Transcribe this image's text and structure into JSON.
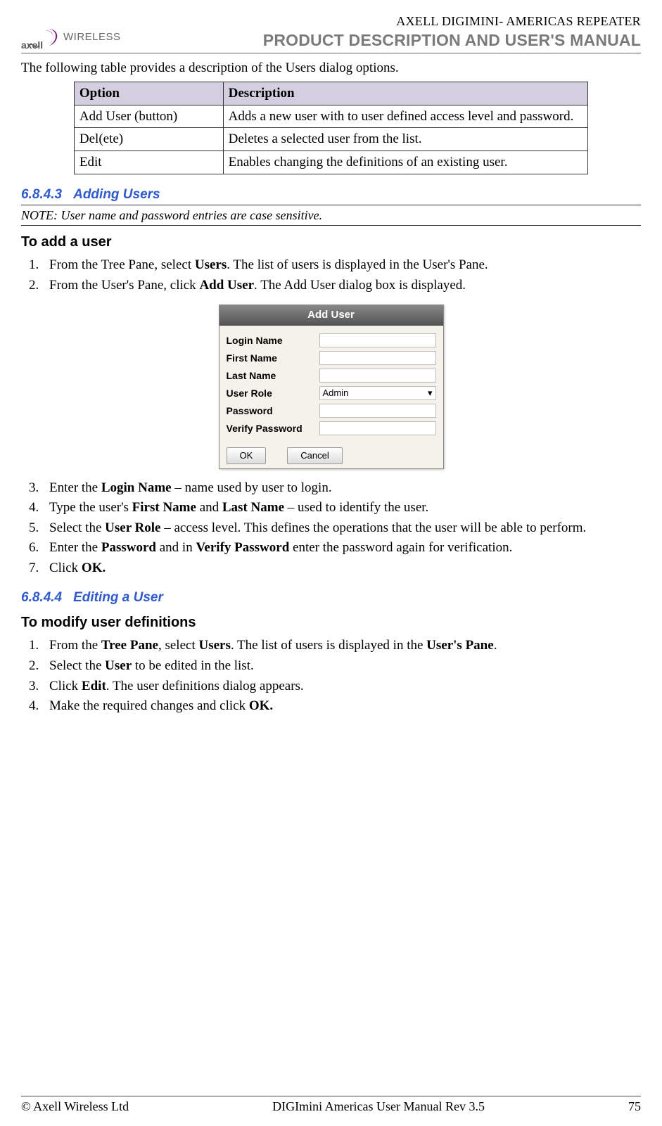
{
  "header": {
    "logo_text": "WIRELESS",
    "line1_a": "A",
    "line1_xell": "XELL ",
    "line1_d": "D",
    "line1_igimini": "IGIMINI",
    "line1_dash": "- ",
    "line1_am": "A",
    "line1_mericas": "MERICAS ",
    "line1_r": "R",
    "line1_epeater": "EPEATER",
    "line2": "PRODUCT DESCRIPTION AND USER'S MANUAL"
  },
  "intro": "The following table provides a description of the Users dialog options.",
  "table": {
    "headers": [
      "Option",
      "Description"
    ],
    "rows": [
      [
        "Add User (button)",
        "Adds a new user with to user defined access level and password."
      ],
      [
        "Del(ete)",
        "Deletes a selected user from the list."
      ],
      [
        "Edit",
        "Enables changing the definitions of an existing user."
      ]
    ]
  },
  "sec1": {
    "num": "6.8.4.3",
    "title": "Adding Users"
  },
  "note": "NOTE: User name and password entries are case sensitive.",
  "subhdr1": "To add a user",
  "steps1": {
    "s1a": "From the Tree Pane, select ",
    "s1b": "Users",
    "s1c": ". The list of users is displayed in the User's Pane.",
    "s2a": "From the User's Pane, click ",
    "s2b": "Add User",
    "s2c": ". The Add User dialog box is displayed.",
    "s3a": "Enter the ",
    "s3b": "Login Name",
    "s3c": " – name used by user to login.",
    "s4a": "Type the user's ",
    "s4b": "First Name",
    "s4c": " and ",
    "s4d": "Last Name",
    "s4e": " – used to identify the user.",
    "s5a": "Select the ",
    "s5b": "User Role",
    "s5c": " – access level. This defines the operations that the user will be able to perform.",
    "s6a": "Enter the ",
    "s6b": "Password",
    "s6c": " and in ",
    "s6d": "Verify Password",
    "s6e": " enter the password again for verification.",
    "s7a": "Click ",
    "s7b": "OK."
  },
  "dialog": {
    "title": "Add User",
    "labels": [
      "Login Name",
      "First Name",
      "Last Name",
      "User Role",
      "Password",
      "Verify Password"
    ],
    "role_value": "Admin",
    "ok": "OK",
    "cancel": "Cancel"
  },
  "sec2": {
    "num": "6.8.4.4",
    "title": "Editing a User"
  },
  "subhdr2": "To modify user definitions",
  "steps2": {
    "s1a": "From the ",
    "s1b": "Tree Pane",
    "s1c": ", select ",
    "s1d": "Users",
    "s1e": ". The list of users is displayed in the ",
    "s1f": "User's Pane",
    "s1g": ".",
    "s2a": "Select the ",
    "s2b": "User",
    "s2c": " to be edited in the list.",
    "s3a": "Click ",
    "s3b": "Edit",
    "s3c": ". The user definitions dialog appears.",
    "s4a": "Make the required changes and click ",
    "s4b": "OK."
  },
  "footer": {
    "left": "© Axell Wireless Ltd",
    "mid": "DIGImini Americas User Manual Rev 3.5",
    "right": "75"
  }
}
